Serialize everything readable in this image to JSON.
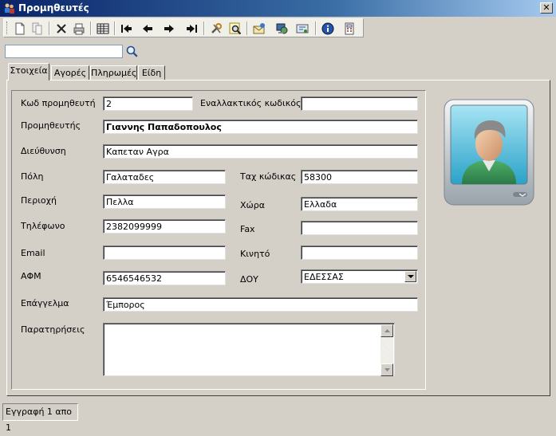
{
  "window": {
    "title": "Προμηθευτές",
    "close_glyph": "✕"
  },
  "toolbar": {
    "buttons": [
      {
        "icon": "new-document-icon"
      },
      {
        "icon": "copy-document-icon"
      },
      {
        "icon": "delete-icon"
      },
      {
        "icon": "print-icon"
      },
      {
        "icon": "grid-icon"
      },
      {
        "icon": "first-record-icon"
      },
      {
        "icon": "previous-record-icon"
      },
      {
        "icon": "next-record-icon"
      },
      {
        "icon": "last-record-icon"
      },
      {
        "icon": "tools-icon"
      },
      {
        "icon": "find-icon"
      },
      {
        "icon": "mail-icon"
      },
      {
        "icon": "network-icon"
      },
      {
        "icon": "export-icon"
      },
      {
        "icon": "info-icon"
      },
      {
        "icon": "calculator-icon"
      }
    ]
  },
  "search": {
    "value": "",
    "button_icon": "search-icon"
  },
  "tabs": [
    {
      "label": "Στοιχεία",
      "active": true
    },
    {
      "label": "Αγορές",
      "active": false
    },
    {
      "label": "Πληρωμές",
      "active": false
    },
    {
      "label": "Είδη",
      "active": false
    }
  ],
  "form": {
    "code_label": "Κωδ προμηθευτή",
    "code_value": "2",
    "altcode_label": "Εναλλακτικός κωδικός",
    "altcode_value": "",
    "supplier_label": "Προμηθευτής",
    "supplier_value": "Γιαννης Παπαδοπουλος",
    "address_label": "Διεύθυνση",
    "address_value": "Καπεταν Αγρα",
    "city_label": "Πόλη",
    "city_value": "Γαλαταδες",
    "zip_label": "Ταχ κώδικας",
    "zip_value": "58300",
    "region_label": "Περιοχή",
    "region_value": "Πελλα",
    "country_label": "Χώρα",
    "country_value": "Ελλαδα",
    "phone_label": "Τηλέφωνο",
    "phone_value": "2382099999",
    "fax_label": "Fax",
    "fax_value": "",
    "email_label": "Email",
    "email_value": "",
    "mobile_label": "Κινητό",
    "mobile_value": "",
    "afm_label": "ΑΦΜ",
    "afm_value": "6546546532",
    "doy_label": "ΔΟΥ",
    "doy_value": "ΕΔΕΣΣΑΣ",
    "profession_label": "Επάγγελμα",
    "profession_value": "Έμπορος",
    "notes_label": "Παρατηρήσεις",
    "notes_value": ""
  },
  "statusbar": {
    "text": "Εγγραφή 1 απο 1"
  },
  "colors": {
    "titlebar_start": "#0a246a",
    "titlebar_end": "#a6caf0",
    "window_bg": "#d4d0c8"
  }
}
